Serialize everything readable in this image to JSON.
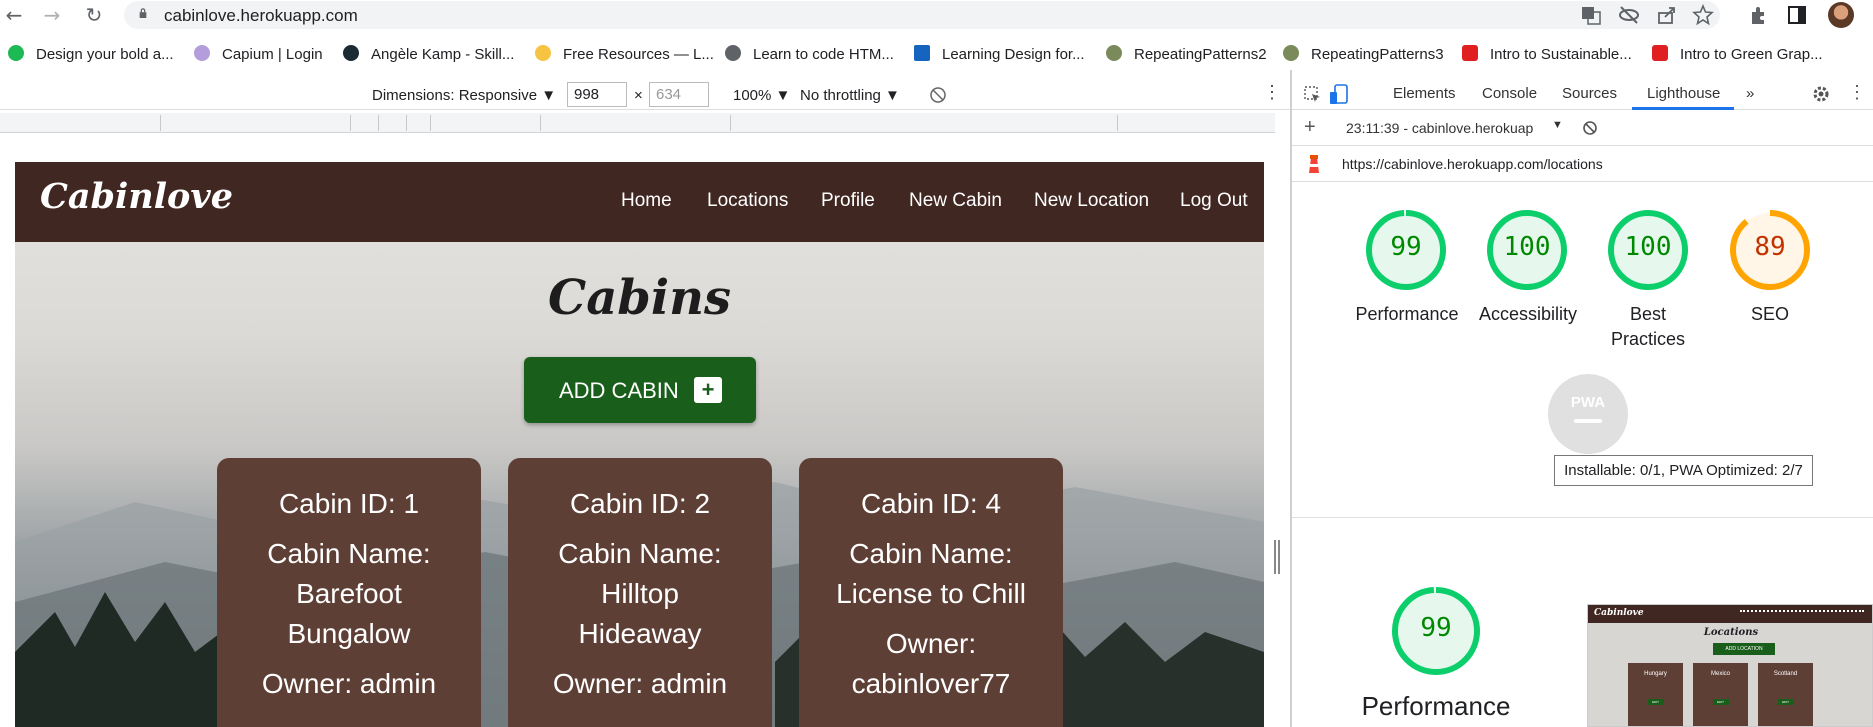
{
  "browser": {
    "url": "cabinlove.herokuapp.com",
    "bookmarks": [
      {
        "label": "Design your bold a...",
        "color": "#1db954"
      },
      {
        "label": "Capium | Login",
        "color": "#b39ddb"
      },
      {
        "label": "Angèle Kamp - Skill...",
        "color": "#1b2a33"
      },
      {
        "label": "Free Resources — L...",
        "color": "#f6c343"
      },
      {
        "label": "Learn to code HTM...",
        "color": "#5f6368"
      },
      {
        "label": "Learning Design for...",
        "color": "#1565c0"
      },
      {
        "label": "RepeatingPatterns2",
        "color": "#7a8a5a"
      },
      {
        "label": "RepeatingPatterns3",
        "color": "#7a8a5a"
      },
      {
        "label": "Intro to Sustainable...",
        "color": "#e02020"
      },
      {
        "label": "Intro to Green Grap...",
        "color": "#e02020"
      }
    ]
  },
  "device_toolbar": {
    "dimensions": "Dimensions: Responsive ▼",
    "width": "998",
    "times": "×",
    "height": "634",
    "zoom": "100% ▼",
    "throttling": "No throttling ▼"
  },
  "site": {
    "logo": "Cabinlove",
    "nav": [
      "Home",
      "Locations",
      "Profile",
      "New Cabin",
      "New Location",
      "Log Out"
    ],
    "title": "Cabins",
    "add_button": "ADD CABIN",
    "add_icon": "+",
    "cards": [
      {
        "id": "Cabin ID: 1",
        "name1": "Cabin Name:",
        "name2": "Barefoot",
        "name3": "Bungalow",
        "owner1": "Owner: admin",
        "owner2": ""
      },
      {
        "id": "Cabin ID: 2",
        "name1": "Cabin Name:",
        "name2": "Hilltop",
        "name3": "Hideaway",
        "owner1": "Owner: admin",
        "owner2": ""
      },
      {
        "id": "Cabin ID: 4",
        "name1": "Cabin Name:",
        "name2": "License to Chill",
        "name3": "",
        "owner1": "Owner:",
        "owner2": "cabinlover77"
      }
    ]
  },
  "devtools": {
    "tabs": [
      "Elements",
      "Console",
      "Sources",
      "Lighthouse",
      "»"
    ],
    "report_time": "23:11:39 - cabinlove.herokuap",
    "report_url": "https://cabinlove.herokuapp.com/locations",
    "scores": [
      {
        "label": "Performance",
        "value": "99",
        "pct": 99,
        "color": "#0cce6b",
        "text": "#008800"
      },
      {
        "label": "Accessibility",
        "value": "100",
        "pct": 100,
        "color": "#0cce6b",
        "text": "#008800"
      },
      {
        "label": "Best Practices",
        "value": "100",
        "pct": 100,
        "color": "#0cce6b",
        "text": "#008800"
      },
      {
        "label": "SEO",
        "value": "89",
        "pct": 89,
        "color": "#ffa400",
        "text": "#c33300"
      }
    ],
    "pwa_label": "PWA",
    "pwa_tooltip": "Installable: 0/1, PWA Optimized: 2/7",
    "perf_score": "99",
    "perf_label": "Performance",
    "thumb": {
      "logo": "Cabinlove",
      "title": "Locations",
      "button": "ADD LOCATION",
      "cards": [
        "Hungary",
        "Mexico",
        "Scotland"
      ],
      "card_button": "EDIT"
    }
  }
}
